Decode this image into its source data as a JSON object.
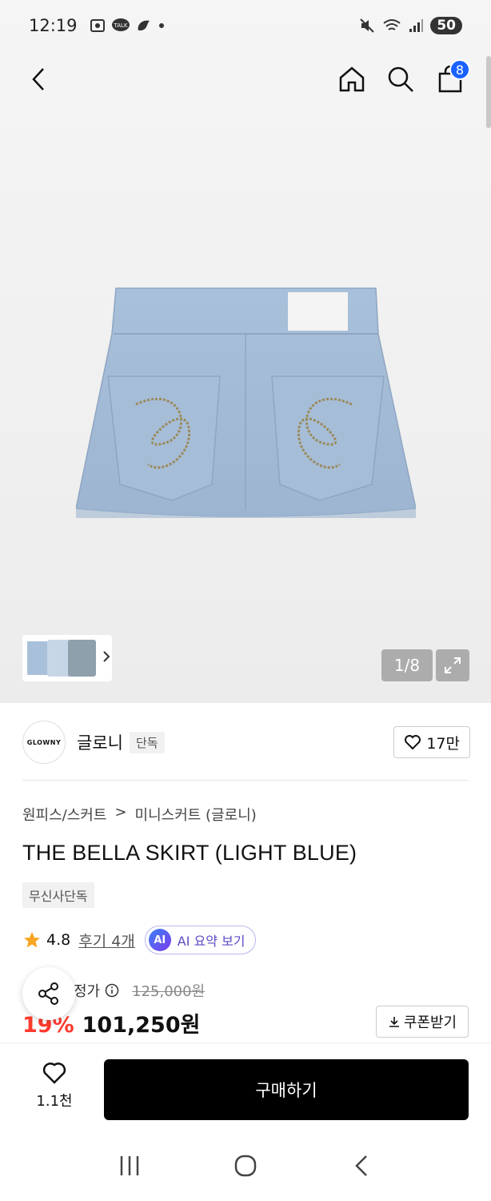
{
  "status_bar": {
    "time": "12:19",
    "battery": "50"
  },
  "top_nav": {
    "cart_count": "8"
  },
  "gallery": {
    "counter": "1/8"
  },
  "brand": {
    "logo_text": "GLOWNY",
    "name": "글로니",
    "tag": "단독",
    "likes": "17만"
  },
  "breadcrumb": {
    "category": "원피스/스커트",
    "separator": ">",
    "subcategory": "미니스커트 (글로니)"
  },
  "product": {
    "title": "THE BELLA SKIRT (LIGHT BLUE)",
    "exclusive_tag": "무신사단독",
    "rating": "4.8",
    "review_link": "후기 4개",
    "ai_badge": "AI",
    "ai_summary": "AI 요약 보기"
  },
  "price": {
    "original_label_visible": "정가",
    "original": "125,000원",
    "discount": "19%",
    "sale": "101,250원",
    "coupon_label": "쿠폰받기"
  },
  "bottom_bar": {
    "wish_count": "1.1천",
    "buy_label": "구매하기"
  },
  "colors": {
    "accent_blue": "#1a62ff",
    "discount_red": "#ff3a2e",
    "buy_button": "#000000"
  }
}
